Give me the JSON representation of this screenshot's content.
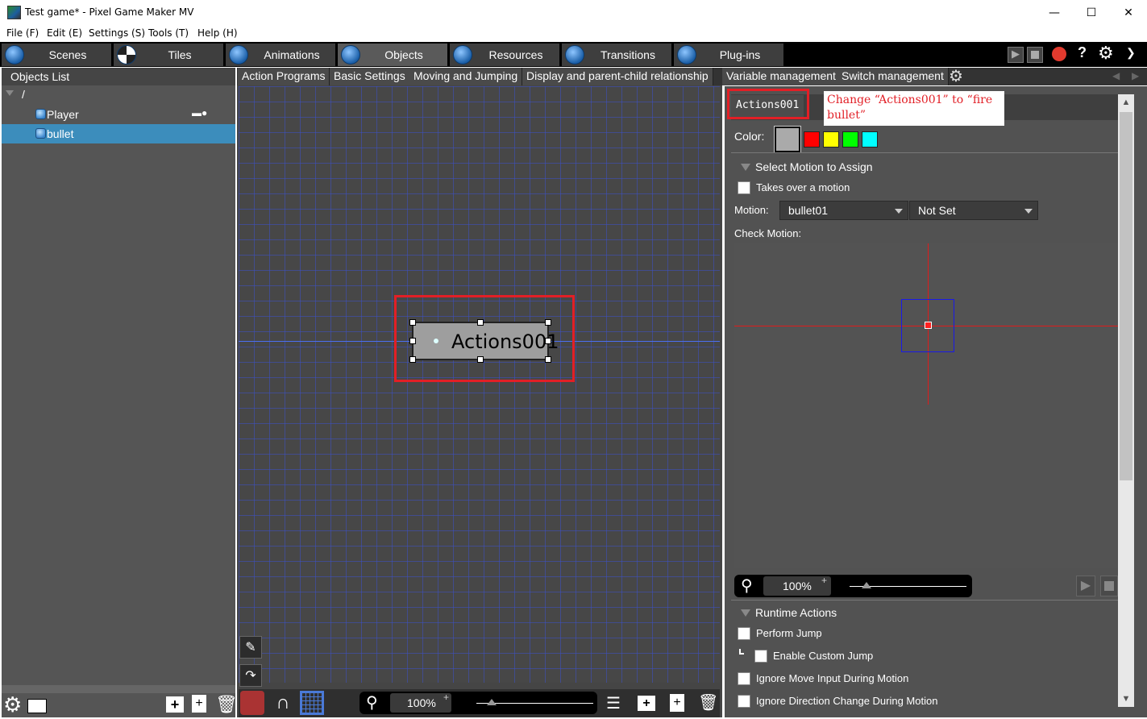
{
  "window": {
    "title": "Test game* - Pixel Game Maker MV",
    "minimize": "—",
    "maximize": "☐",
    "close": "✕"
  },
  "menu": [
    "File (F)",
    "Edit (E)",
    "Settings (S)",
    "Tools (T)",
    "Help (H)"
  ],
  "main_tabs": [
    {
      "label": "Scenes",
      "icon": "scenes-icon"
    },
    {
      "label": "Tiles",
      "icon": "tiles-icon"
    },
    {
      "label": "Animations",
      "icon": "animations-icon"
    },
    {
      "label": "Objects",
      "icon": "objects-icon",
      "active": true
    },
    {
      "label": "Resources",
      "icon": "resources-icon"
    },
    {
      "label": "Transitions",
      "icon": "transitions-icon"
    },
    {
      "label": "Plug-ins",
      "icon": "plugins-icon"
    }
  ],
  "objects_list": {
    "header": "Objects List",
    "root": "/",
    "items": [
      {
        "label": "Player",
        "selected": false
      },
      {
        "label": "bullet",
        "selected": true
      }
    ]
  },
  "sub_tabs": [
    "Action Programs",
    "Basic Settings",
    "Moving and Jumping",
    "Display and parent-child relationship",
    "Variable management",
    "Switch management"
  ],
  "canvas": {
    "action_node_label": "Actions001",
    "zoom": "100%",
    "zoom_plus": "+"
  },
  "properties": {
    "name_value": "Actions001",
    "annotation": "Change “Actions001” to “fire bullet”",
    "color_label": "Color:",
    "colors": [
      "#aaaaaa",
      "#ff0000",
      "#ffff00",
      "#00ff00",
      "#00ffff"
    ],
    "select_motion_heading": "Select Motion to Assign",
    "takes_over_label": "Takes over a motion",
    "motion_label": "Motion:",
    "motion_value": "bullet01",
    "motion_value2": "Not Set",
    "check_motion_label": "Check Motion:",
    "preview_zoom": "100%",
    "preview_zoom_plus": "+",
    "runtime_heading": "Runtime Actions",
    "runtime_items": [
      "Perform Jump",
      "Enable Custom Jump",
      "Ignore Move Input During Motion",
      "Ignore Direction Change During Motion"
    ]
  }
}
